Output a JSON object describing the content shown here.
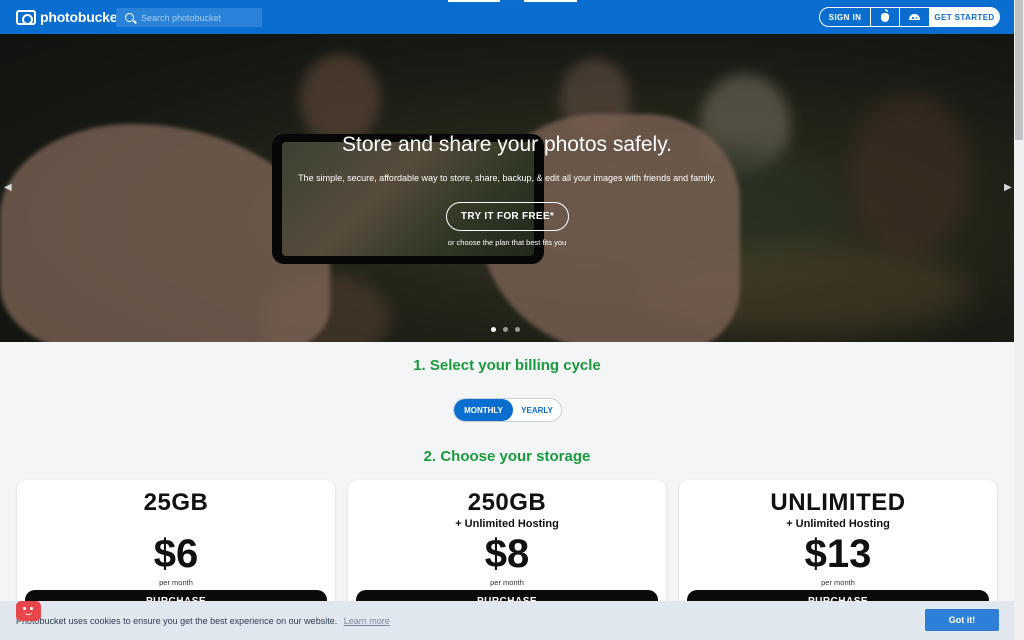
{
  "header": {
    "logo_text": "photobucket",
    "search_placeholder": "Search photobucket",
    "sign_in": "SIGN IN",
    "apple_icon": "apple-icon",
    "android_icon": "android-icon",
    "get_started": "GET STARTED"
  },
  "hero": {
    "title": "Store and share your photos safely.",
    "subtitle": "The simple, secure, affordable way to store, share, backup, & edit all your images with friends and family.",
    "cta": "TRY IT FOR FREE*",
    "note": "or choose the plan that best fits you",
    "slides": 3,
    "active_slide": 1
  },
  "billing": {
    "title": "1. Select your billing cycle",
    "options": [
      "MONTHLY",
      "YEARLY"
    ],
    "selected": "MONTHLY"
  },
  "storage": {
    "title": "2. Choose your storage",
    "plans": [
      {
        "size": "25GB",
        "extra": "",
        "price": "$6",
        "period": "per month",
        "button": "PURCHASE"
      },
      {
        "size": "250GB",
        "extra": "+ Unlimited Hosting",
        "price": "$8",
        "period": "per month",
        "button": "PURCHASE"
      },
      {
        "size": "UNLIMITED",
        "extra": "+ Unlimited Hosting",
        "price": "$13",
        "period": "per month",
        "button": "PURCHASE"
      }
    ]
  },
  "cookie": {
    "text": "Photobucket uses cookies to ensure you get the best experience on our website.",
    "learn_more": "Learn more",
    "accept": "Got it!"
  },
  "colors": {
    "brand_blue": "#0a6ed1",
    "step_green": "#1a9a3c",
    "cookie_bg": "#e1e7ee",
    "badge_red": "#e8464a"
  }
}
